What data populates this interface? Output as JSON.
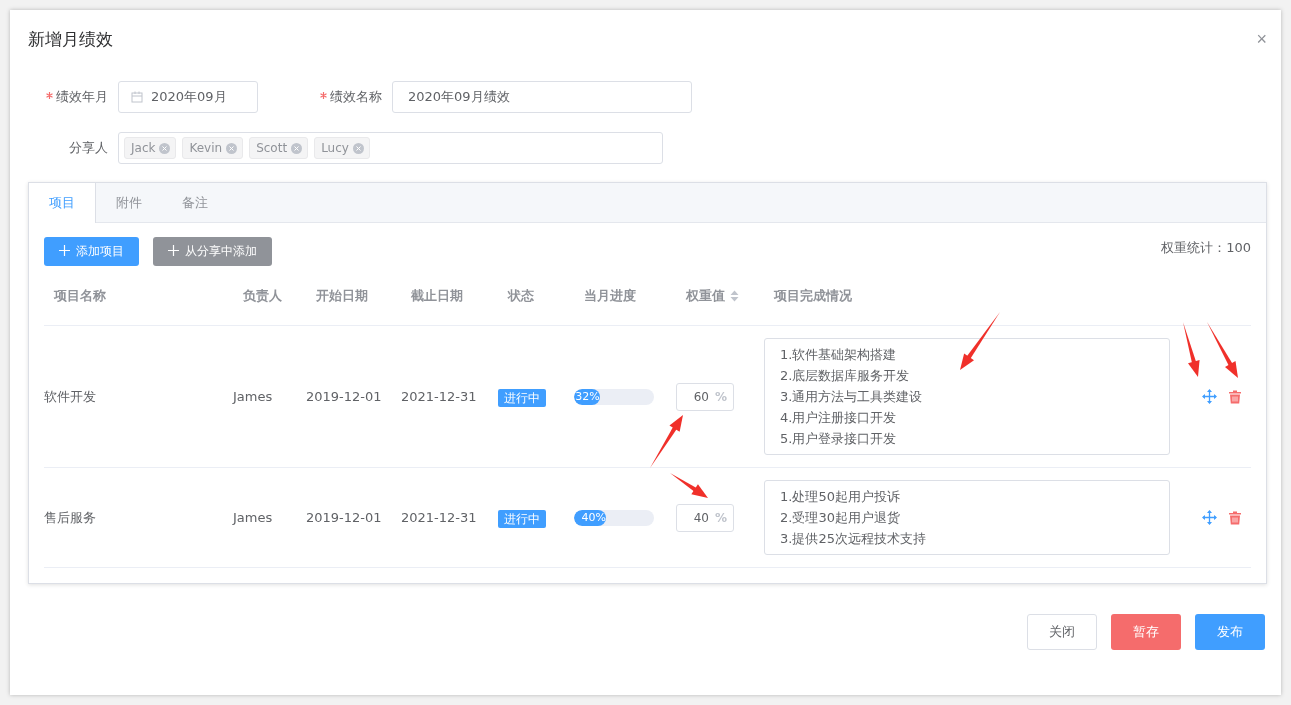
{
  "dialog": {
    "title": "新增月绩效",
    "close": "×"
  },
  "form": {
    "month": {
      "label": "绩效年月",
      "required": true,
      "value": "2020年09月"
    },
    "name": {
      "label": "绩效名称",
      "required": true,
      "value": "2020年09月绩效"
    },
    "sharers": {
      "label": "分享人",
      "tags": [
        "Jack",
        "Kevin",
        "Scott",
        "Lucy"
      ]
    }
  },
  "tabs": [
    {
      "label": "项目",
      "selected": true
    },
    {
      "label": "附件",
      "selected": false
    },
    {
      "label": "备注",
      "selected": false
    }
  ],
  "toolbar": {
    "buttons": [
      {
        "label": "添加项目",
        "kind": "primary"
      },
      {
        "label": "从分享中添加",
        "kind": "secondary"
      }
    ],
    "weight_total": "权重统计：100"
  },
  "table": {
    "columns": [
      "项目名称",
      "负责人",
      "开始日期",
      "截止日期",
      "状态",
      "当月进度",
      "权重值",
      "项目完成情况"
    ],
    "rows": [
      {
        "name": "软件开发",
        "owner": "James",
        "start": "2019-12-01",
        "end": "2021-12-31",
        "status": "进行中",
        "level": 0.32,
        "progress": "32%",
        "weight": "60",
        "unit": "%",
        "completion": [
          "1.软件基础架构搭建",
          "2.底层数据库服务开发",
          "3.通用方法与工具类建设",
          "4.用户注册接口开发",
          "5.用户登录接口开发"
        ]
      },
      {
        "name": "售后服务",
        "owner": "James",
        "start": "2019-12-01",
        "end": "2021-12-31",
        "status": "进行中",
        "level": 0.4,
        "progress": "40%",
        "weight": "40",
        "unit": "%",
        "completion": [
          "1.处理50起用户投诉",
          "2.受理30起用户退货",
          "3.提供25次远程技术支持"
        ]
      }
    ]
  },
  "footer": {
    "buttons": [
      {
        "label": "关闭",
        "kind": "default"
      },
      {
        "label": "暂存",
        "kind": "danger"
      },
      {
        "label": "发布",
        "kind": "primary"
      }
    ]
  }
}
